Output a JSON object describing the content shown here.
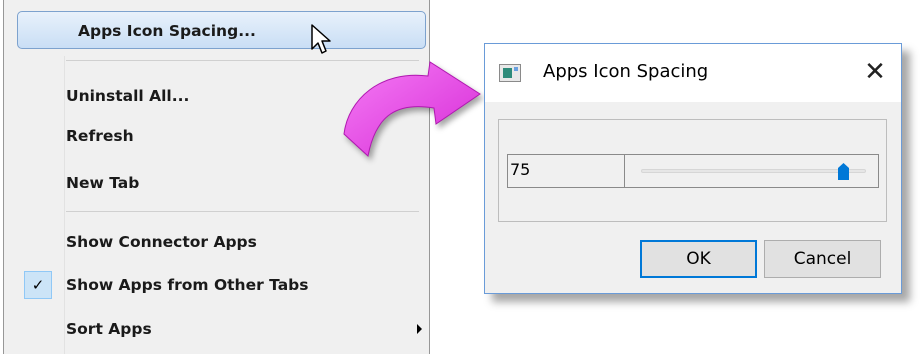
{
  "menu": {
    "highlighted_item": "Apps Icon Spacing...",
    "items": [
      {
        "label": "Uninstall All..."
      },
      {
        "label": "Refresh"
      },
      {
        "label": "New Tab"
      },
      {
        "label": "Show Connector Apps"
      },
      {
        "label": "Show Apps from Other Tabs",
        "checked": true
      },
      {
        "label": "Sort Apps",
        "has_submenu": true
      }
    ],
    "check_glyph": "✓"
  },
  "dialog": {
    "title": "Apps Icon Spacing",
    "close_glyph": "✕",
    "spacing_value": "75",
    "slider_fraction": 0.9,
    "ok_label": "OK",
    "cancel_label": "Cancel"
  },
  "colors": {
    "accent": "#0078d7",
    "arrow": "#e040e0",
    "titlebar": "#ffffff"
  }
}
